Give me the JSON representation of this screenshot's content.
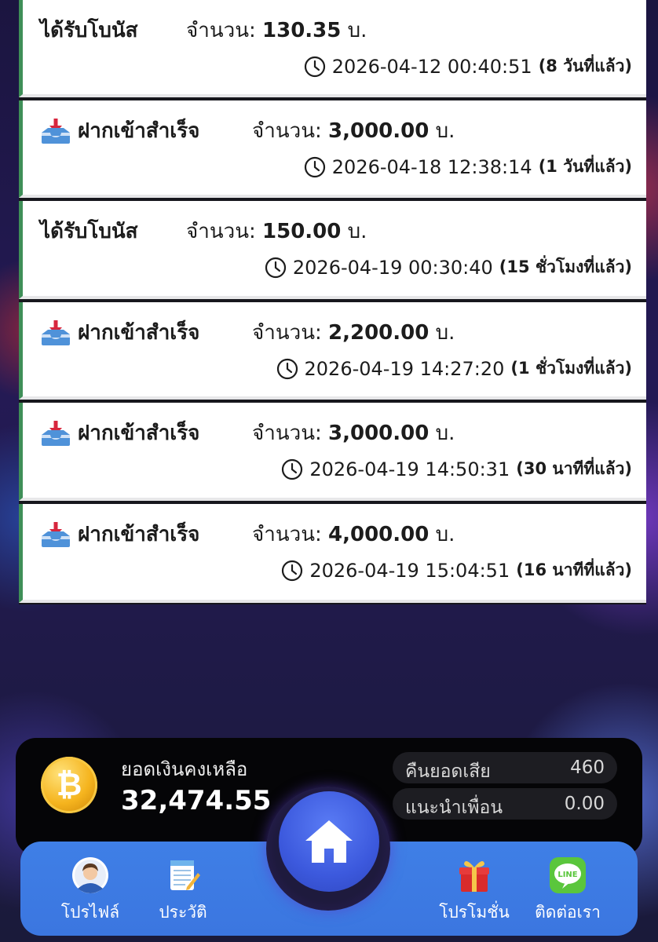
{
  "transactions": [
    {
      "type": "ได้รับโบนัส",
      "icon": "",
      "amount_label": "จำนวน:",
      "amount": "130.35",
      "unit": "บ.",
      "time": "2026-04-12 00:40:51",
      "ago": "(8 วันที่แล้ว)"
    },
    {
      "type": "ฝากเข้าสำเร็จ",
      "icon": "inbox-tray-icon",
      "amount_label": "จำนวน:",
      "amount": "3,000.00",
      "unit": "บ.",
      "time": "2026-04-18 12:38:14",
      "ago": "(1 วันที่แล้ว)"
    },
    {
      "type": "ได้รับโบนัส",
      "icon": "",
      "amount_label": "จำนวน:",
      "amount": "150.00",
      "unit": "บ.",
      "time": "2026-04-19 00:30:40",
      "ago": "(15 ชั่วโมงที่แล้ว)"
    },
    {
      "type": "ฝากเข้าสำเร็จ",
      "icon": "inbox-tray-icon",
      "amount_label": "จำนวน:",
      "amount": "2,200.00",
      "unit": "บ.",
      "time": "2026-04-19 14:27:20",
      "ago": "(1 ชั่วโมงที่แล้ว)"
    },
    {
      "type": "ฝากเข้าสำเร็จ",
      "icon": "inbox-tray-icon",
      "amount_label": "จำนวน:",
      "amount": "3,000.00",
      "unit": "บ.",
      "time": "2026-04-19 14:50:31",
      "ago": "(30 นาทีที่แล้ว)"
    },
    {
      "type": "ฝากเข้าสำเร็จ",
      "icon": "inbox-tray-icon",
      "amount_label": "จำนวน:",
      "amount": "4,000.00",
      "unit": "บ.",
      "time": "2026-04-19 15:04:51",
      "ago": "(16 นาทีที่แล้ว)"
    }
  ],
  "balance": {
    "label": "ยอดเงินคงเหลือ",
    "value": "32,474.55",
    "coin_symbol": "₿",
    "cashback_label": "คืนยอดเสีย",
    "cashback_value": "460",
    "referral_label": "แนะนำเพื่อน",
    "referral_value": "0.00"
  },
  "nav": {
    "profile": "โปรไฟล์",
    "history": "ประวัติ",
    "home_icon": "home-icon",
    "promotion": "โปรโมชั่น",
    "contact": "ติดต่อเรา",
    "line_text": "LINE"
  },
  "colors": {
    "card_accent": "#3f8f58",
    "nav_bg": "#3f7fe6",
    "home_button": "#3c59dd",
    "coin": "#f5b41e"
  }
}
